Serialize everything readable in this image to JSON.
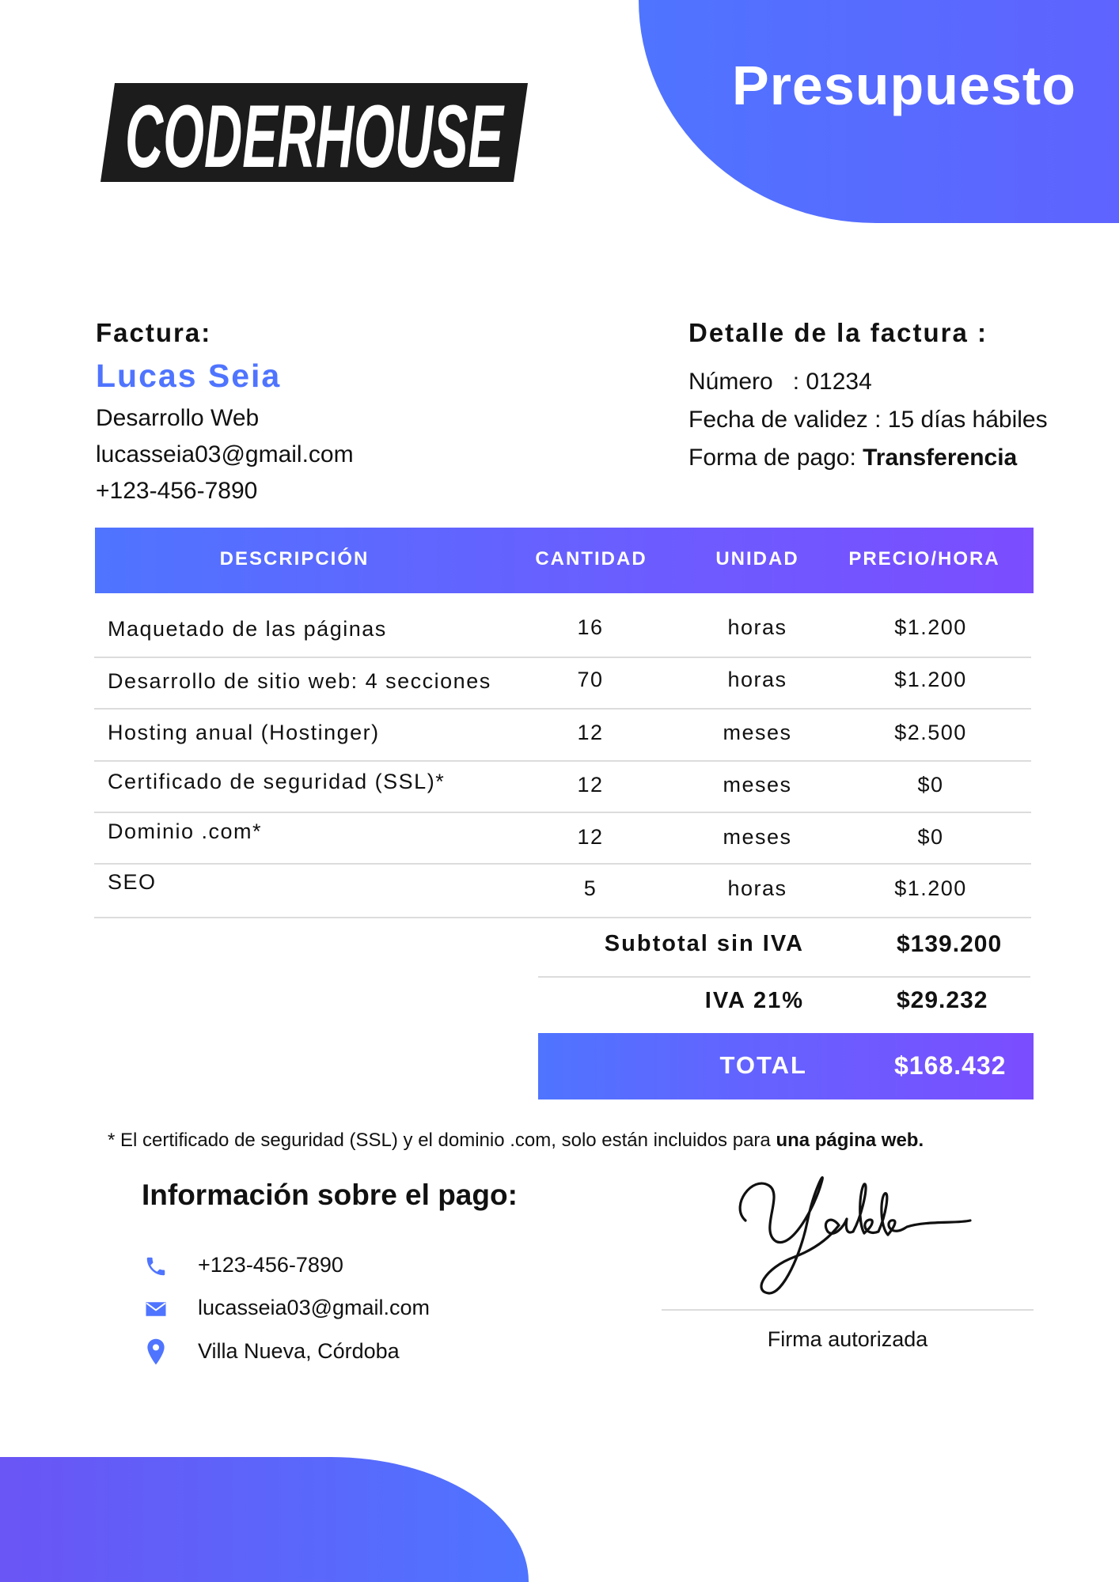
{
  "document": {
    "title": "Presupuesto",
    "logo_text": "CODERHOUSE"
  },
  "bill_to": {
    "label": "Factura:",
    "name": "Lucas Seia",
    "role": "Desarrollo Web",
    "email": "lucasseia03@gmail.com",
    "phone": "+123-456-7890"
  },
  "details": {
    "title": "Detalle de la factura :",
    "number_line": "Número   : 01234",
    "validity_line": "Fecha de validez : 15 días hábiles",
    "payment_label": "Forma de pago: ",
    "payment_value": "Transferencia"
  },
  "table": {
    "headers": [
      "DESCRIPCIÓN",
      "CANTIDAD",
      "UNIDAD",
      "PRECIO/HORA"
    ],
    "rows": [
      {
        "desc": "Maquetado de las páginas",
        "qty": "16",
        "unit": "horas",
        "price": "$1.200"
      },
      {
        "desc": "Desarrollo de sitio web: 4 secciones",
        "qty": "70",
        "unit": "horas",
        "price": "$1.200"
      },
      {
        "desc": "Hosting anual (Hostinger)",
        "qty": "12",
        "unit": "meses",
        "price": "$2.500"
      },
      {
        "desc": "Certificado de seguridad (SSL)*",
        "qty": "12",
        "unit": "meses",
        "price": "$0"
      },
      {
        "desc": "Dominio .com*",
        "qty": "12",
        "unit": "meses",
        "price": "$0"
      },
      {
        "desc": "SEO",
        "qty": "5",
        "unit": "horas",
        "price": "$1.200"
      }
    ]
  },
  "totals": {
    "subtotal_label": "Subtotal sin IVA",
    "subtotal_value": "$139.200",
    "tax_label": "IVA 21%",
    "tax_value": "$29.232",
    "total_label": "TOTAL",
    "total_value": "$168.432"
  },
  "footnote": {
    "text": "* El certificado de seguridad (SSL) y el dominio .com, solo están incluidos para ",
    "bold": "una página web."
  },
  "payment_info": {
    "title": "Información sobre el pago:",
    "phone": "+123-456-7890",
    "email": "lucasseia03@gmail.com",
    "location": "Villa Nueva, Córdoba",
    "icons": [
      "phone-icon",
      "mail-icon",
      "location-pin-icon"
    ],
    "icon_color": "#4f74ff"
  },
  "signature": {
    "caption": "Firma autorizada"
  },
  "colors": {
    "accent": "#4f74ff",
    "accent_purple": "#7b4dff"
  }
}
